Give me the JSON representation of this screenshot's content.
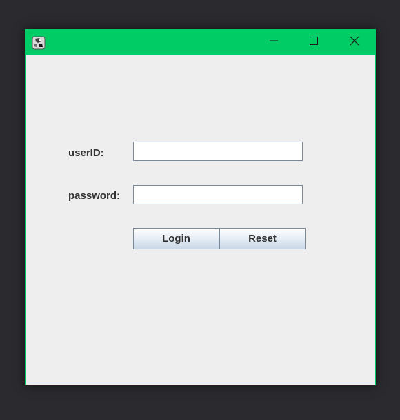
{
  "colors": {
    "titlebar": "#00cc66",
    "window_border": "#00c864",
    "desktop": "#2b2a2e",
    "content_bg": "#eeeeee",
    "label_text": "#333333"
  },
  "titlebar": {
    "app_icon": "java-app-icon",
    "minimize_icon": "minimize-icon",
    "maximize_icon": "maximize-icon",
    "close_icon": "close-icon"
  },
  "form": {
    "userid_label": "userID:",
    "userid_value": "",
    "password_label": "password:",
    "password_value": "",
    "login_label": "Login",
    "reset_label": "Reset"
  }
}
